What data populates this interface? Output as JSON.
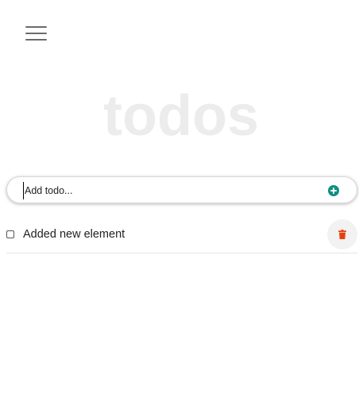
{
  "header": {
    "menu_icon": "hamburger-menu-icon"
  },
  "app": {
    "title": "todos"
  },
  "add_todo": {
    "placeholder": "Add todo...",
    "value": "",
    "add_icon": "plus-circle-icon",
    "accent_color": "#0f8f83"
  },
  "todos": [
    {
      "text": "Added new element",
      "completed": false,
      "delete_icon": "trash-icon",
      "delete_color": "#e8400c"
    }
  ]
}
